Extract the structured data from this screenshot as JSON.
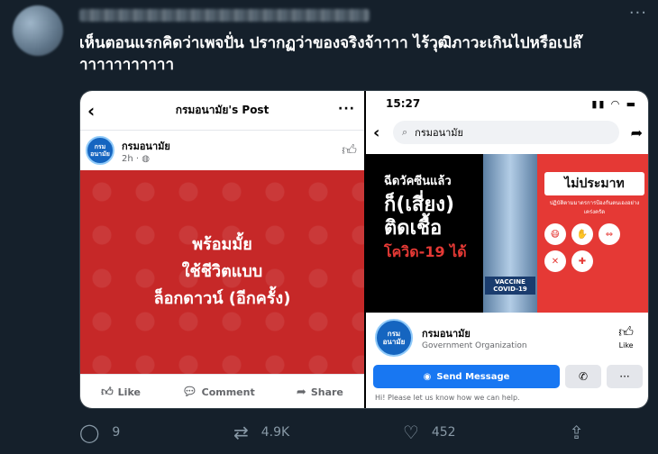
{
  "tweet": {
    "text": "เห็นตอนแรกคิดว่าเพจปั่น ปรากฏว่าของจริงจ้าาาา ไร้วุฒิภาวะเกินไปหรือเปล๊าาาาาาาาาาา",
    "stats": {
      "replies": "9",
      "retweets": "4.9K",
      "likes": "452"
    }
  },
  "left_screenshot": {
    "header_title": "กรมอนามัย's Post",
    "author": "กรมอนามัย",
    "time": "2h · ◍",
    "logo_text": "กรม อนามัย",
    "banner_lines": [
      "พร้อมมั้ย",
      "ใช้ชีวิตแบบ",
      "ล็อกดาวน์ (อีกครั้ง)"
    ],
    "actions": {
      "like": "Like",
      "comment": "Comment",
      "share": "Share"
    }
  },
  "right_screenshot": {
    "time": "15:27",
    "search_value": "กรมอนามัย",
    "ad_lines": [
      "ฉีดวัคซีนแล้ว",
      "ก็(เสี่ยง)",
      "ติดเชื้อ",
      "โควิด-19 ได้"
    ],
    "ad_right_title": "ไม่ประมาท",
    "ad_right_sub": "ปฏิบัติตามมาตรการป้องกันตนเองอย่างเคร่งครัด",
    "vial_label": "VACCINE COVID-19",
    "page_name": "กรมอนามัย",
    "page_category": "Government Organization",
    "like_label": "Like",
    "send_label": "Send Message",
    "hint": "Hi! Please let us know how we can help."
  },
  "colors": {
    "background": "#15202b",
    "facebook_blue": "#1877f2",
    "banner_red": "#c62828"
  }
}
